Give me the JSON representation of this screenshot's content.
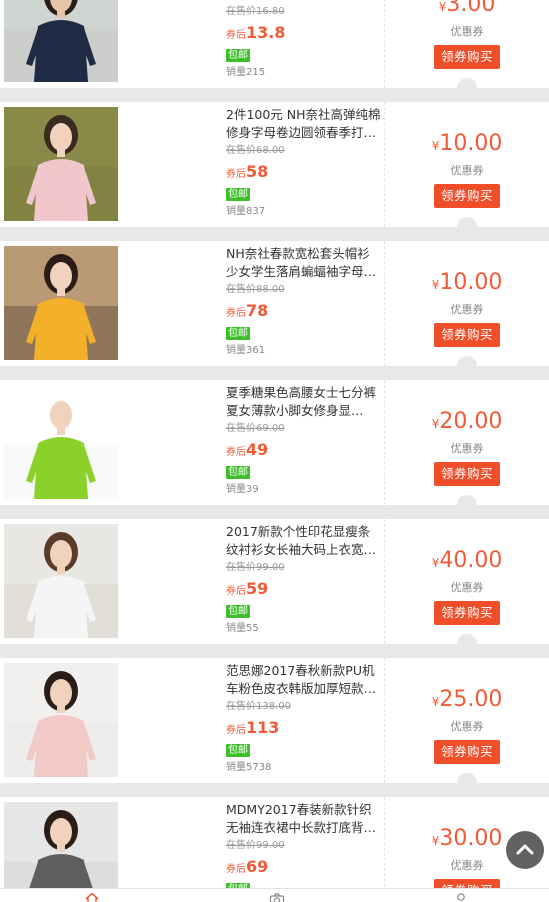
{
  "labels": {
    "original_price_prefix": "在售价",
    "after_coupon_prefix": "券后",
    "free_shipping": "包邮",
    "sales_prefix": "销量",
    "yen": "¥",
    "coupon_label": "优惠券",
    "buy_button": "领券购买"
  },
  "colors": {
    "accent": "#ef4e29",
    "price": "#f05a36",
    "free_badge": "#3cbf28"
  },
  "products": [
    {
      "title": "",
      "original_price": "16.80",
      "after_price": "13.8",
      "sales": "215",
      "coupon": "3.00",
      "photo": {
        "bg": "#cfd6d2",
        "cloth": "#1f2a44",
        "skin": "#e8c4a8",
        "hair": "#2a1d17",
        "top": "#c9c9c4"
      }
    },
    {
      "title": "2件100元 NH奈社高弹纯棉修身字母卷边圆领春季打…",
      "original_price": "68.00",
      "after_price": "58",
      "sales": "837",
      "coupon": "10.00",
      "photo": {
        "bg": "#8a8a48",
        "cloth": "#f1c6cc",
        "skin": "#f0d2bd",
        "hair": "#3a2a20",
        "top": "#7b7d3e"
      }
    },
    {
      "title": "NH奈社春款宽松套头帽衫少女学生落肩蝙蝠袖字母…",
      "original_price": "88.00",
      "after_price": "78",
      "sales": "361",
      "coupon": "10.00",
      "photo": {
        "bg": "#b99a74",
        "cloth": "#f3b12a",
        "skin": "#f0d2bd",
        "hair": "#2a1d17",
        "top": "#6e5a45"
      }
    },
    {
      "title": "夏季糖果色高腰女士七分裤夏女薄款小脚女修身显…",
      "original_price": "69.00",
      "after_price": "49",
      "sales": "39",
      "coupon": "20.00",
      "photo": {
        "bg": "#ffffff",
        "cloth": "#8ad22a",
        "skin": "#f0d2bd",
        "hair": "#ffffff",
        "top": "#f4f4f4"
      }
    },
    {
      "title": "2017新款个性印花显瘦条纹衬衫女长袖大码上衣宽…",
      "original_price": "99.00",
      "after_price": "59",
      "sales": "55",
      "coupon": "40.00",
      "photo": {
        "bg": "#e9e7e3",
        "cloth": "#f5f5f5",
        "skin": "#f0d2bd",
        "hair": "#5a3a28",
        "top": "#dcd8d2"
      }
    },
    {
      "title": "范思娜2017春秋新款PU机车粉色皮衣韩版加厚短款…",
      "original_price": "138.00",
      "after_price": "113",
      "sales": "5738",
      "coupon": "25.00",
      "photo": {
        "bg": "#f2f0ee",
        "cloth": "#f1c9c6",
        "skin": "#f0d2bd",
        "hair": "#2a1d17",
        "top": "#ecebe9"
      }
    },
    {
      "title": "MDMY2017春装新款针织无袖连衣裙中长款打底背…",
      "original_price": "99.00",
      "after_price": "69",
      "sales": "",
      "coupon": "30.00",
      "photo": {
        "bg": "#e6e6e6",
        "cloth": "#5e5e5e",
        "skin": "#f0d2bd",
        "hair": "#2a1d17",
        "top": "#d5d5d5"
      }
    }
  ],
  "bottom_nav": {
    "icons": [
      "home-icon",
      "camera-icon",
      "user-icon"
    ]
  },
  "back_to_top": {
    "icon": "chevron-up-icon"
  }
}
